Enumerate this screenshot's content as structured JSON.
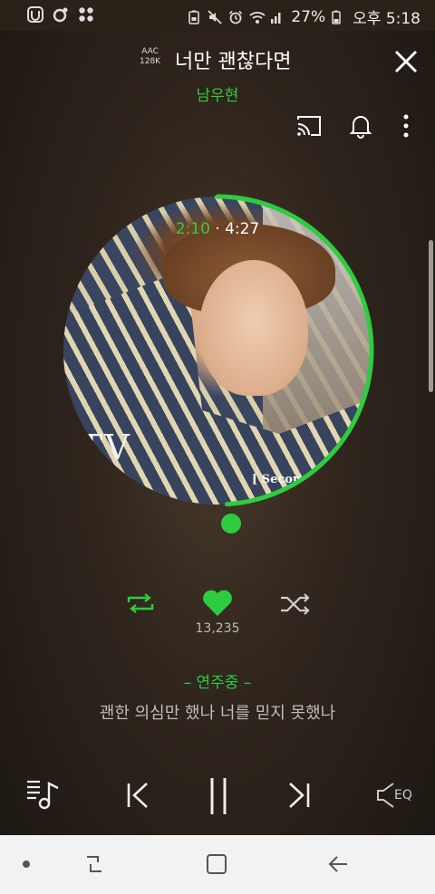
{
  "status_bar": {
    "battery_percent": "27%",
    "time": "오후 5:18",
    "icons": [
      "app-icon-1",
      "app-icon-2",
      "app-grid-icon",
      "battery-lock-icon",
      "mute-icon",
      "alarm-icon",
      "wifi-icon",
      "signal-icon",
      "battery-icon"
    ]
  },
  "header": {
    "quality_top": "AAC",
    "quality_bottom": "128K",
    "song_title": "너만 괜찮다면",
    "artist": "남우현"
  },
  "album": {
    "time_current": "2:10",
    "time_separator": "·",
    "time_total": "4:27",
    "progress_fraction": 0.49,
    "art_text_1": "TV",
    "art_text_2": "[ Secon"
  },
  "actions": {
    "like_count": "13,235"
  },
  "lyrics": {
    "status_label": "– 연주중 –",
    "current_line": "괜한 의심만 했나 너를 믿지 못했나"
  },
  "controls": {
    "eq_label": "EQ"
  },
  "colors": {
    "accent": "#2ecc40",
    "background": "#2e241c",
    "navbar": "#f2f2f2"
  }
}
